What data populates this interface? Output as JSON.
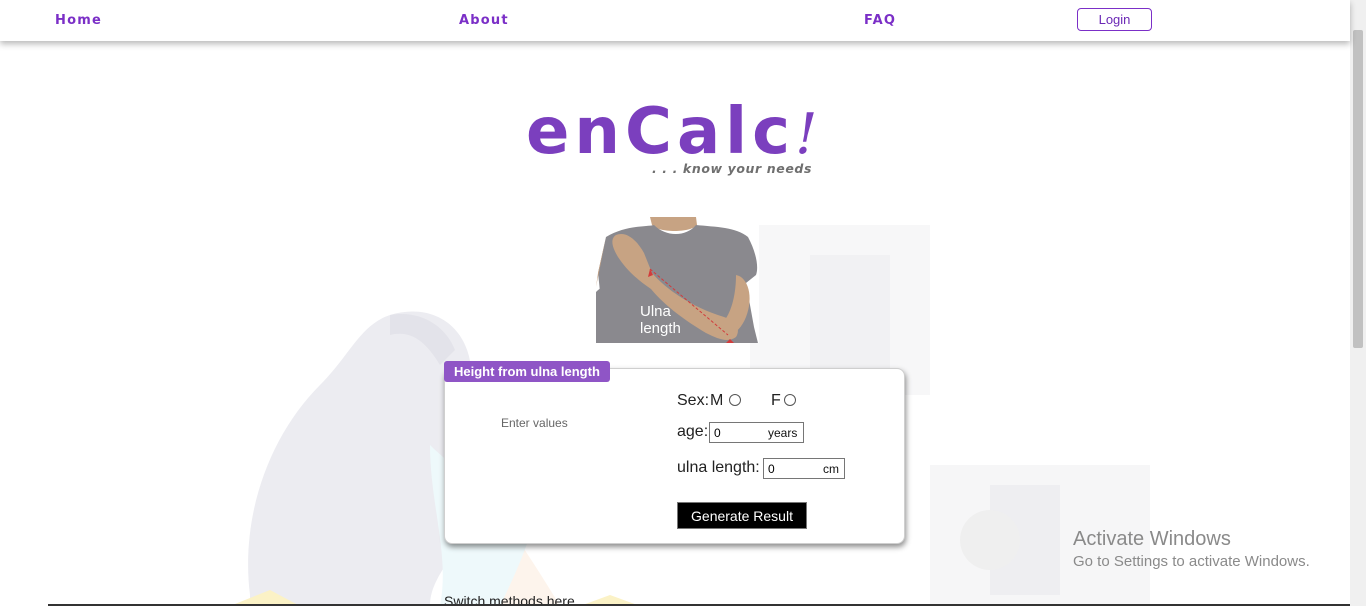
{
  "nav": {
    "home": "Home",
    "about": "About",
    "faq": "FAQ",
    "login": "Login"
  },
  "logo": {
    "text": "enCalc",
    "bang": "!",
    "tagline": ". . . know your needs"
  },
  "figure": {
    "label_line1": "Ulna",
    "label_line2": "length"
  },
  "card": {
    "tab_title": "Height from ulna length",
    "enter_values": "Enter values",
    "sex_label": "Sex:",
    "sex_m": "M",
    "sex_f": "F",
    "age_label": "age:",
    "age_value": "0",
    "age_unit": "years",
    "ulna_label": "ulna length:",
    "ulna_value": "0",
    "ulna_unit": "cm",
    "generate_button": "Generate Result"
  },
  "footer": {
    "switch_methods": "Switch methods here"
  },
  "watermark": {
    "title": "Activate Windows",
    "subtitle": "Go to Settings to activate Windows."
  },
  "colors": {
    "brand_purple": "#7b3fbe",
    "tab_purple": "#8f55c6",
    "button_black": "#000000"
  }
}
